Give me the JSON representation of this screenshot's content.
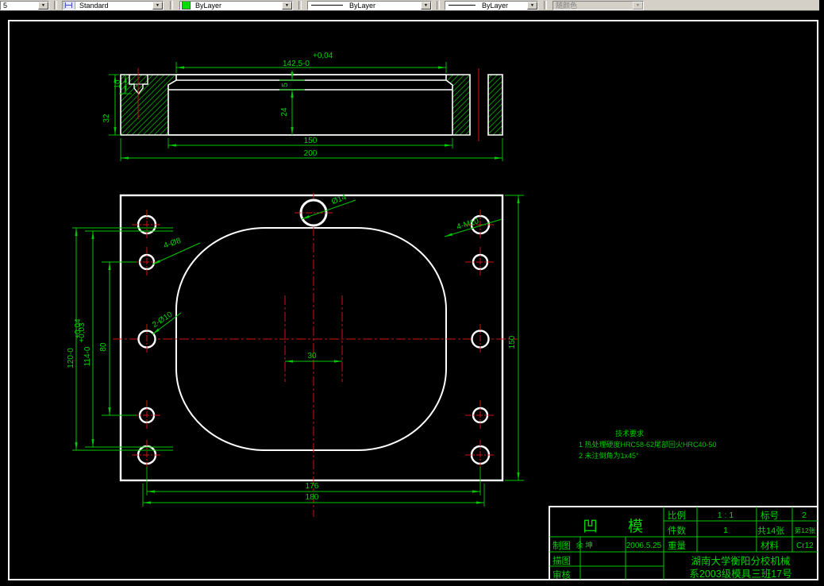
{
  "toolbar": {
    "combo_partial": "5",
    "combo_style": "Standard",
    "combo_color": "ByLayer",
    "combo_linetype": "ByLayer",
    "combo_lineweight": "ByLayer",
    "combo_plotstyle": "随颜色"
  },
  "colors": {
    "dimension_green": "#00c800",
    "outline_white": "#ffffff",
    "centerline_red": "#cc1414",
    "toolbar_gray": "#d4d0c8",
    "swatch_green": "#00dd00",
    "canvas_black": "#000000"
  },
  "section_view": {
    "dim_top_value": "142,5-0",
    "dim_top_tol": "+0,04",
    "dim_step": "5",
    "dim_depth": "24",
    "dim_cbore": "10",
    "dim_thickness": "32",
    "dim_inner_width": "150",
    "dim_overall_width": "200"
  },
  "plan_view": {
    "dim_height": "150",
    "dim_span_inner": "176",
    "dim_span_outer": "180",
    "dim_center": "30",
    "dim_cavity_h": "120-0",
    "dim_cavity_h_tol": "+0,04",
    "dim_inner_h": "114-0",
    "dim_inner_h_tol": "+0,03",
    "dim_rows": "80",
    "label_center_hole": "Ø14",
    "label_corner_holes": "4-M10",
    "label_screw_holes": "4-Ø8",
    "label_dowel_holes": "2-Ø10"
  },
  "tech_req": {
    "title": "技术要求",
    "notes": [
      "1 热处理硬度HRC58-62尾部回火HRC40-50",
      "2 未注倒角为1x45°"
    ]
  },
  "title_block": {
    "part_name": "凹模",
    "scale_label": "比例",
    "scale_value": "1 : 1",
    "mark_label": "标号",
    "mark_value": "2",
    "qty_label": "件数",
    "qty_value": "1",
    "sheets_total": "共14张",
    "sheet_index": "第12张",
    "drawn_label": "制图",
    "drawn_name": "余 坤",
    "drawn_date": "2006.5.25",
    "weight_label": "重量",
    "material_label": "材料",
    "material_value": "Cr12",
    "trace_label": "描图",
    "check_label": "审核",
    "org_line1": "湖南大学衡阳分校机械",
    "org_line2": "系2003级模具三班17号"
  }
}
